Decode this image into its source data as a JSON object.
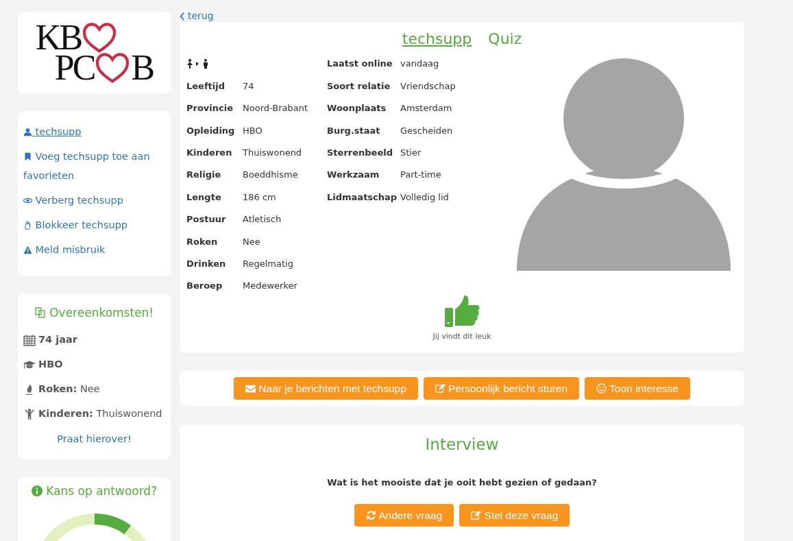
{
  "back_link": {
    "label": "terug"
  },
  "logo": {
    "line_1": "KB",
    "line_2_left": "PC",
    "line_2_right": "B"
  },
  "user_menu": [
    {
      "kind": "profile",
      "label": "techsupp"
    },
    {
      "kind": "favorite",
      "label": "Voeg techsupp toe aan favorieten"
    },
    {
      "kind": "hide",
      "label": "Verberg techsupp"
    },
    {
      "kind": "block",
      "label": "Blokkeer techsupp"
    },
    {
      "kind": "report",
      "label": "Meld misbruik"
    }
  ],
  "matches": {
    "title": "Overeenkomsten!",
    "items": [
      {
        "kind": "age",
        "label": "74 jaar"
      },
      {
        "kind": "education",
        "label": "HBO"
      },
      {
        "kind": "smoking",
        "label": "Roken:",
        "value": "Nee"
      },
      {
        "kind": "children",
        "label": "Kinderen:",
        "value": "Thuiswonend"
      }
    ],
    "link": "Praat hierover!"
  },
  "reply_chance": {
    "title": "Kans op antwoord?",
    "level": 0.1
  },
  "profile": {
    "username": "techsupp",
    "quiz": "Quiz",
    "left_fields": [
      {
        "label": "Leeftijd",
        "value": "74"
      },
      {
        "label": "Provincie",
        "value": "Noord-Brabant"
      },
      {
        "label": "Opleiding",
        "value": "HBO"
      },
      {
        "label": "Kinderen",
        "value": "Thuiswonend"
      },
      {
        "label": "Religie",
        "value": "Boeddhisme"
      },
      {
        "label": "Lengte",
        "value": "186 cm"
      },
      {
        "label": "Postuur",
        "value": "Atletisch"
      },
      {
        "label": "Roken",
        "value": "Nee"
      },
      {
        "label": "Drinken",
        "value": "Regelmatig"
      },
      {
        "label": "Beroep",
        "value": "Medewerker"
      }
    ],
    "right_fields": [
      {
        "label": "Laatst online",
        "value": "vandaag"
      },
      {
        "label": "Soort relatie",
        "value": "Vriendschap"
      },
      {
        "label": "Woonplaats",
        "value": "Amsterdam"
      },
      {
        "label": "Burg.staat",
        "value": "Gescheiden"
      },
      {
        "label": "Sterrenbeeld",
        "value": "Stier"
      },
      {
        "label": "Werkzaam",
        "value": "Part-time"
      },
      {
        "label": "Lidmaatschap",
        "value": "Volledig lid"
      }
    ],
    "liked": true,
    "like_caption": "Jij vindt dit leuk"
  },
  "actions": [
    {
      "kind": "mail",
      "label": "Naar je berichten met techsupp"
    },
    {
      "kind": "edit",
      "label": "Persoonlijk bericht sturen"
    },
    {
      "kind": "smile",
      "label": "Toon interesse"
    }
  ],
  "interview": {
    "title": "Interview",
    "question": "Wat is het mooiste dat je ooit hebt gezien of gedaan?",
    "buttons": [
      {
        "kind": "refresh",
        "label": "Andere vraag"
      },
      {
        "kind": "edit",
        "label": "Stel deze vraag"
      }
    ]
  }
}
